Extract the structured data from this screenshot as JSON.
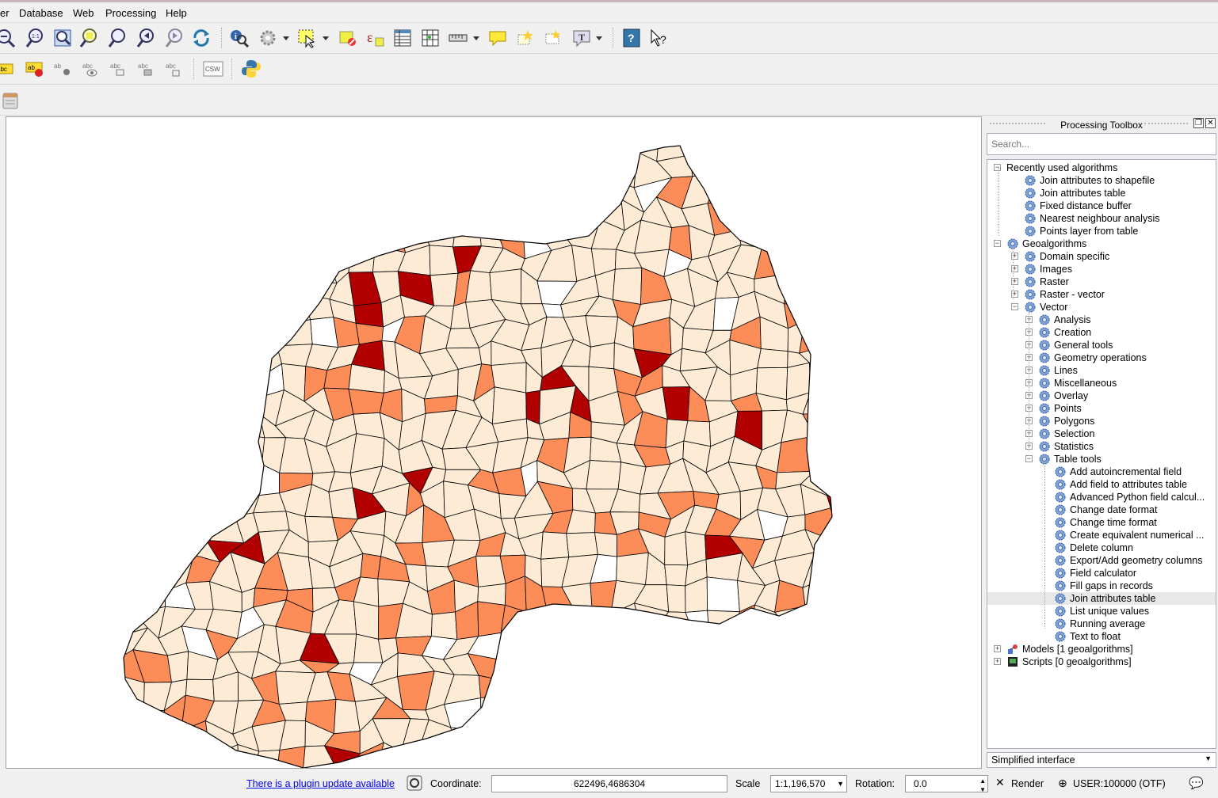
{
  "menu": [
    "er",
    "Database",
    "Web",
    "Processing",
    "Help"
  ],
  "toolbar_icons": {
    "row1": [
      "zoom-out-icon",
      "zoom-native-icon",
      "zoom-full-icon",
      "zoom-selection-icon",
      "zoom-layer-icon",
      "zoom-last-icon",
      "zoom-next-icon",
      "refresh-icon",
      "identify-icon",
      "action-icon",
      "select-features-icon",
      "deselect-icon",
      "expression-select-icon",
      "attribute-table-icon",
      "statistics-icon",
      "measure-icon",
      "annotation-icon",
      "map-tips-icon",
      "bookmark-icon",
      "text-annotation-icon",
      "help-icon",
      "whats-this-icon"
    ],
    "row2": [
      "label-icon",
      "label-style-icon",
      "pin-label-icon",
      "show-hide-label-icon",
      "move-label-icon",
      "rotate-label-icon",
      "change-label-icon",
      "csw-icon",
      "python-icon"
    ],
    "row3": [
      "database-icon"
    ],
    "csw_text": "CSW"
  },
  "panel": {
    "title": "Processing Toolbox",
    "search_placeholder": "Search...",
    "tree": [
      {
        "label": "Recently used algorithms",
        "level": 0,
        "exp": "−",
        "icon": false
      },
      {
        "label": "Join attributes to shapefile",
        "level": 1,
        "icon": true
      },
      {
        "label": "Join attributes table",
        "level": 1,
        "icon": true
      },
      {
        "label": "Fixed distance buffer",
        "level": 1,
        "icon": true
      },
      {
        "label": "Nearest neighbour analysis",
        "level": 1,
        "icon": true
      },
      {
        "label": "Points layer from table",
        "level": 1,
        "icon": true
      },
      {
        "label": "Geoalgorithms",
        "level": 0,
        "exp": "−",
        "icon": true
      },
      {
        "label": "Domain specific",
        "level": 1,
        "exp": "+",
        "icon": true
      },
      {
        "label": "Images",
        "level": 1,
        "exp": "+",
        "icon": true
      },
      {
        "label": "Raster",
        "level": 1,
        "exp": "+",
        "icon": true
      },
      {
        "label": "Raster - vector",
        "level": 1,
        "exp": "+",
        "icon": true
      },
      {
        "label": "Vector",
        "level": 1,
        "exp": "−",
        "icon": true
      },
      {
        "label": "Analysis",
        "level": 2,
        "exp": "+",
        "icon": true
      },
      {
        "label": "Creation",
        "level": 2,
        "exp": "+",
        "icon": true
      },
      {
        "label": "General tools",
        "level": 2,
        "exp": "+",
        "icon": true
      },
      {
        "label": "Geometry operations",
        "level": 2,
        "exp": "+",
        "icon": true
      },
      {
        "label": "Lines",
        "level": 2,
        "exp": "+",
        "icon": true
      },
      {
        "label": "Miscellaneous",
        "level": 2,
        "exp": "+",
        "icon": true
      },
      {
        "label": "Overlay",
        "level": 2,
        "exp": "+",
        "icon": true
      },
      {
        "label": "Points",
        "level": 2,
        "exp": "+",
        "icon": true
      },
      {
        "label": "Polygons",
        "level": 2,
        "exp": "+",
        "icon": true
      },
      {
        "label": "Selection",
        "level": 2,
        "exp": "+",
        "icon": true
      },
      {
        "label": "Statistics",
        "level": 2,
        "exp": "+",
        "icon": true
      },
      {
        "label": "Table tools",
        "level": 2,
        "exp": "−",
        "icon": true
      },
      {
        "label": "Add autoincremental field",
        "level": 3,
        "icon": true
      },
      {
        "label": "Add field to attributes table",
        "level": 3,
        "icon": true
      },
      {
        "label": "Advanced Python field calcul...",
        "level": 3,
        "icon": true
      },
      {
        "label": "Change date format",
        "level": 3,
        "icon": true
      },
      {
        "label": "Change time format",
        "level": 3,
        "icon": true
      },
      {
        "label": "Create equivalent numerical ...",
        "level": 3,
        "icon": true
      },
      {
        "label": "Delete column",
        "level": 3,
        "icon": true
      },
      {
        "label": "Export/Add geometry columns",
        "level": 3,
        "icon": true
      },
      {
        "label": "Field calculator",
        "level": 3,
        "icon": true
      },
      {
        "label": "Fill gaps in records",
        "level": 3,
        "icon": true
      },
      {
        "label": "Join attributes table",
        "level": 3,
        "icon": true,
        "selected": true
      },
      {
        "label": "List unique values",
        "level": 3,
        "icon": true
      },
      {
        "label": "Running average",
        "level": 3,
        "icon": true
      },
      {
        "label": "Text to float",
        "level": 3,
        "icon": true
      },
      {
        "label": "Models [1 geoalgorithms]",
        "level": 0,
        "exp": "+",
        "icon": true,
        "special": "models"
      },
      {
        "label": "Scripts [0 geoalgorithms]",
        "level": 0,
        "exp": "+",
        "icon": true,
        "special": "scripts"
      }
    ],
    "mode": "Simplified interface"
  },
  "status": {
    "plugin_link": "There is a plugin update available",
    "coordinate_label": "Coordinate:",
    "coordinate_value": "622496,4686304",
    "scale_label": "Scale",
    "scale_value": "1:1,196,570",
    "rotation_label": "Rotation:",
    "rotation_value": "0.0",
    "render_label": "Render",
    "crs_label": "USER:100000 (OTF)"
  },
  "map": {
    "class_colors": [
      "#fdebd6",
      "#fc8d59",
      "#b20000",
      "#ffffff"
    ]
  }
}
